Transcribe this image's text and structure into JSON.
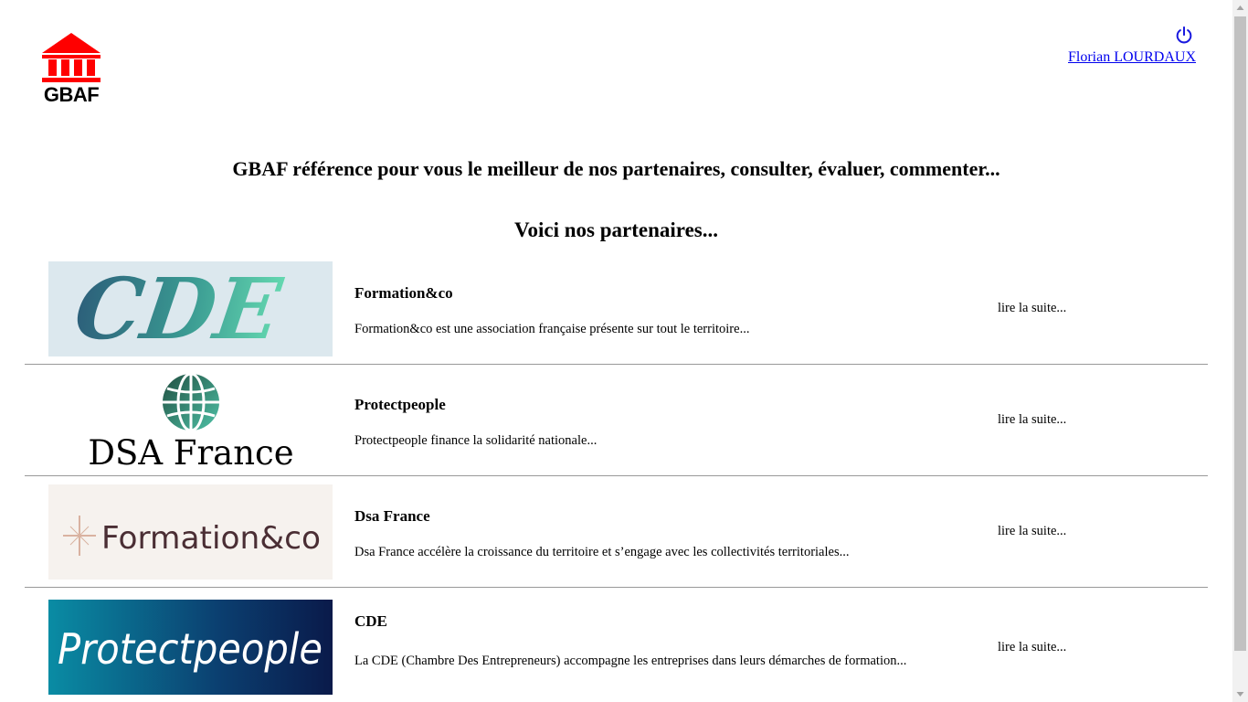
{
  "header": {
    "logo_text": "GBAF",
    "user_name": "Florian LOURDAUX"
  },
  "main": {
    "tagline": "GBAF référence pour vous le meilleur de nos partenaires, consulter, évaluer, commenter...",
    "subtitle": "Voici nos partenaires..."
  },
  "partners": [
    {
      "logo_text": "CDE",
      "name": "Formation&co",
      "description": "Formation&co est une association française présente sur tout le territoire...",
      "more_label": "lire la suite..."
    },
    {
      "logo_text": "DSA France",
      "name": "Protectpeople",
      "description": "Protectpeople finance la solidarité nationale...",
      "more_label": "lire la suite..."
    },
    {
      "logo_text": "Formation&co",
      "name": "Dsa France",
      "description": "Dsa France accélère la croissance du territoire et s’engage avec les collectivités territoriales...",
      "more_label": "lire la suite..."
    },
    {
      "logo_text": "Protectpeople",
      "name": "CDE",
      "description": "La CDE (Chambre Des Entrepreneurs) accompagne les entreprises dans leurs démarches de formation...",
      "more_label": "lire la suite..."
    }
  ],
  "colors": {
    "logo_red": "#ff0000",
    "link_blue": "#0000ee",
    "divider": "#999999"
  },
  "icons": {
    "logout": "power-icon"
  }
}
